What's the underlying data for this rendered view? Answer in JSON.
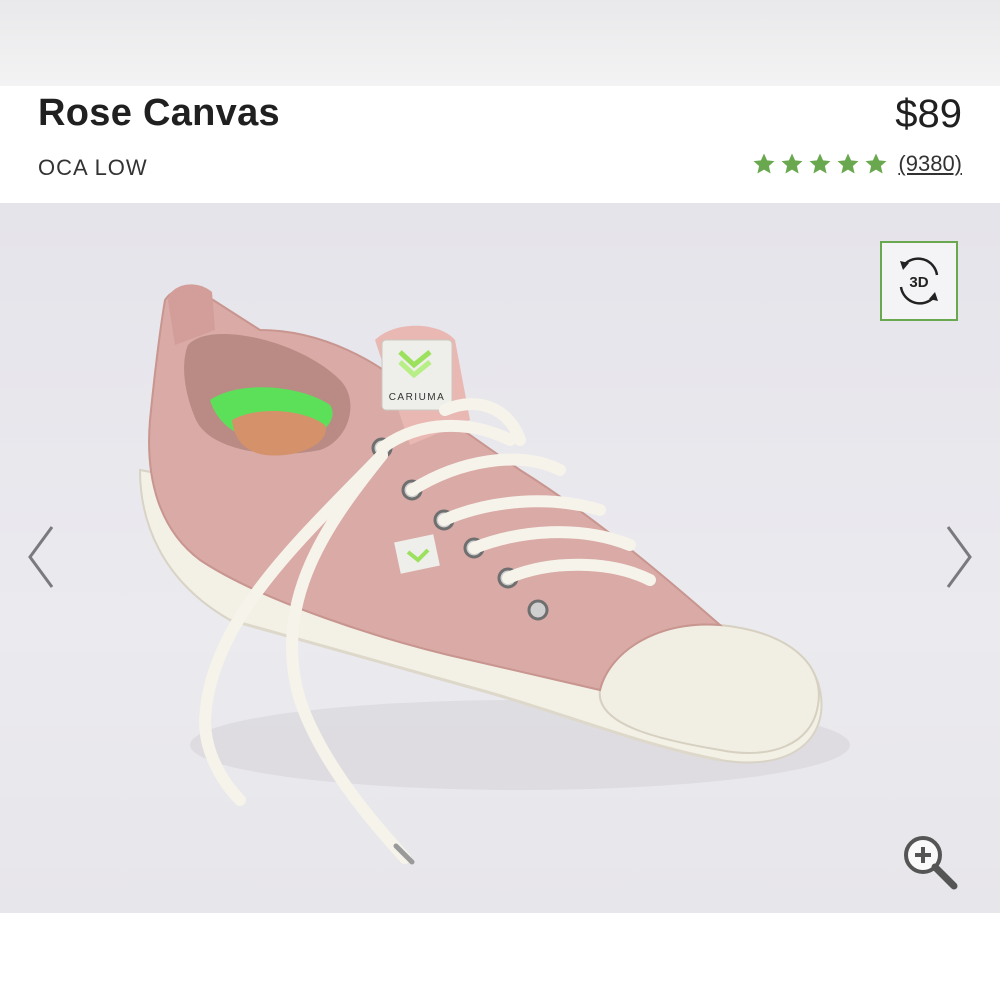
{
  "product": {
    "name": "Rose Canvas",
    "model": "OCA LOW",
    "price": "$89",
    "rating": {
      "stars": 5,
      "review_count_label": "(9380)"
    }
  },
  "gallery": {
    "badge_3d": "3D",
    "shoe_brand_tag": "CARIUMA"
  },
  "icons": {
    "star": "star-icon",
    "view_3d": "rotate-3d-icon",
    "prev": "chevron-left-icon",
    "next": "chevron-right-icon",
    "zoom": "zoom-in-icon"
  },
  "colors": {
    "accent_green": "#6aa84f",
    "shoe_canvas": "#d9aaa6",
    "sole": "#f3f0e6"
  }
}
